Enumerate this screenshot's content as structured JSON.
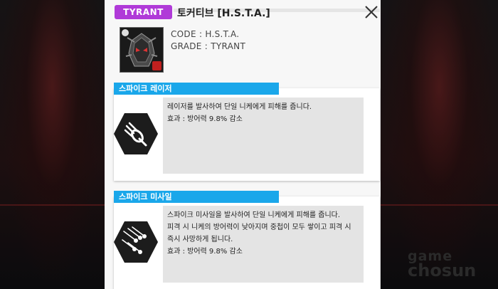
{
  "header": {
    "rarity_badge": "TYRANT",
    "title": "토커티브 [H.S.T.A.]"
  },
  "info": {
    "code": "CODE : H.S.T.A.",
    "grade": "GRADE : TYRANT"
  },
  "skills": [
    {
      "name": "스파이크 레이저",
      "icon": "laser-strike-icon",
      "lines": [
        "레이저를 발사하여 단일 니케에게 피해를 줍니다.",
        "효과 : 방어력 9.8% 감소"
      ]
    },
    {
      "name": "스파이크 미사일",
      "icon": "missile-barrage-icon",
      "lines": [
        "스파이크 미사일을 발사하여 단일 니케에게 피해를 줍니다.",
        "피격 시 니케의 방어력이 낮아지며 중첩이 모두 쌓이고 피격 시",
        "즉시 사망하게 됩니다.",
        "효과 : 방어력 9.8% 감소"
      ]
    }
  ],
  "watermark": {
    "line1": "game",
    "line2": "chosun"
  },
  "colors": {
    "rarity": "#b03ad8",
    "skill_header": "#1aa7ea",
    "panel_bg": "#f7f7f7",
    "desc_bg": "#e4e4e4"
  }
}
